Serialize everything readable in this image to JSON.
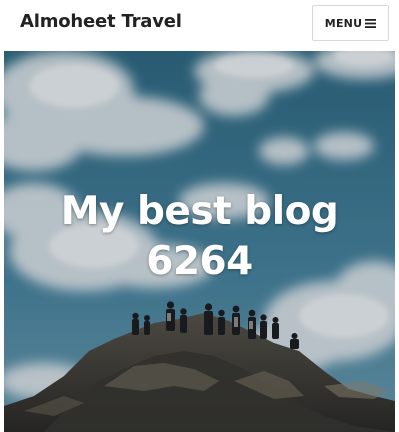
{
  "header": {
    "site_title": "Almoheet Travel",
    "menu_label": "MENU"
  },
  "hero": {
    "title_line1": "My best blog",
    "title_line2": "6264"
  },
  "icons": {
    "menu": "hamburger-icon"
  },
  "colors": {
    "sky": "#3a6f86",
    "title_text": "#ffffff",
    "site_title": "#222222"
  }
}
